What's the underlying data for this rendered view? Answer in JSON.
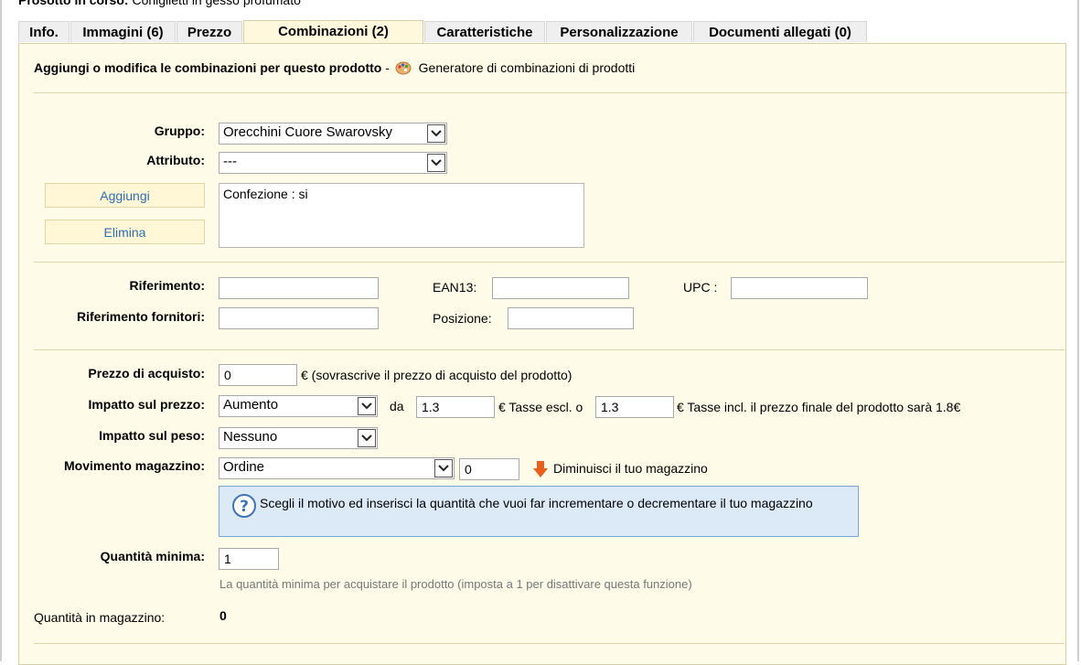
{
  "page": {
    "title_label": "Prosotto in corso:",
    "title_value": "Coniglietti in gesso profumato"
  },
  "tabs": [
    {
      "label": "Info."
    },
    {
      "label": "Immagini (6)"
    },
    {
      "label": "Prezzo"
    },
    {
      "label": "Combinazioni (2)",
      "active": true
    },
    {
      "label": "Caratteristiche"
    },
    {
      "label": "Personalizzazione"
    },
    {
      "label": "Documenti allegati (0)"
    }
  ],
  "header": {
    "text": "Aggiungi o modifica le combinazioni per questo prodotto",
    "dash": "-",
    "generator_link": "Generatore di combinazioni di prodotti"
  },
  "attributes": {
    "group_label": "Gruppo:",
    "group_value": "Orecchini Cuore Swarovsky",
    "attribute_label": "Attributo:",
    "attribute_value": "---",
    "add_button": "Aggiungi",
    "delete_button": "Elimina",
    "selected_list": "Confezione : si"
  },
  "references": {
    "reference_label": "Riferimento:",
    "reference_value": "",
    "ean13_label": "EAN13:",
    "ean13_value": "",
    "upc_label": "UPC :",
    "upc_value": "",
    "supplier_ref_label": "Riferimento fornitori:",
    "supplier_ref_value": "",
    "position_label": "Posizione:",
    "position_value": ""
  },
  "pricing": {
    "purchase_label": "Prezzo di acquisto:",
    "purchase_value": "0",
    "purchase_note": "€ (sovrascrive il prezzo di acquisto del prodotto)",
    "price_impact_label": "Impatto sul prezzo:",
    "price_impact_value": "Aumento",
    "da": "da",
    "tax_excl_value": "1.3",
    "tax_excl_label": "€ Tasse escl. o",
    "tax_incl_value": "1.3",
    "tax_incl_label": "€ Tasse incl. il prezzo finale del prodotto sarà 1.8€",
    "weight_impact_label": "Impatto sul peso:",
    "weight_impact_value": "Nessuno",
    "stock_move_label": "Movimento magazzino:",
    "stock_move_value": "Ordine",
    "stock_move_qty": "0",
    "stock_move_note": "Diminuisci il tuo magazzino",
    "hint": "Scegli il motivo ed inserisci la quantità che vuoi far incrementare o decrementare il tuo magazzino",
    "min_qty_label": "Quantità minima:",
    "min_qty_value": "1",
    "min_qty_note": "La quantità minima per acquistare il prodotto (imposta a 1 per disattivare questa funzione)",
    "stock_qty_label": "Quantità in magazzino:",
    "stock_qty_value": "0"
  }
}
